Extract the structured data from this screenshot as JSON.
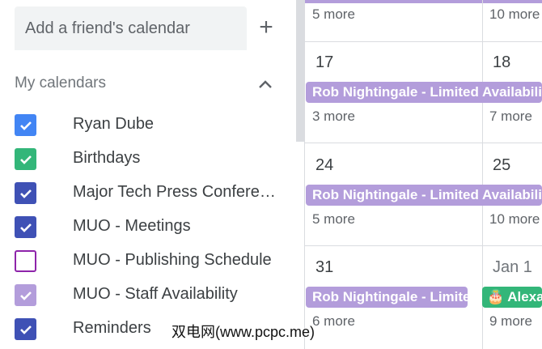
{
  "sidebar": {
    "add_friend_placeholder": "Add a friend's calendar",
    "add_icon": "plus-icon",
    "my_calendars_title": "My calendars",
    "collapse_icon": "chevron-up-icon",
    "calendars": [
      {
        "label": "Ryan Dube",
        "checked": true,
        "color": "#4285f4"
      },
      {
        "label": "Birthdays",
        "checked": true,
        "color": "#33b679"
      },
      {
        "label": "Major Tech Press Confere…",
        "checked": true,
        "color": "#3f51b5"
      },
      {
        "label": "MUO - Meetings",
        "checked": true,
        "color": "#3f51b5"
      },
      {
        "label": "MUO - Publishing Schedule",
        "checked": false,
        "color": "#8e24aa"
      },
      {
        "label": "MUO - Staff Availability",
        "checked": true,
        "color": "#b39ddb"
      },
      {
        "label": "Reminders",
        "checked": true,
        "color": "#3f51b5"
      }
    ]
  },
  "calendar": {
    "event_color": "#b39ddb",
    "birthday_color": "#33b679",
    "week1": {
      "more_left": "5 more",
      "more_right": "10 more"
    },
    "week2": {
      "date_left": "17",
      "date_right": "18",
      "event": "Rob Nightingale - Limited Availability",
      "more_left": "3 more",
      "more_right": "7 more"
    },
    "week3": {
      "date_left": "24",
      "date_right": "25",
      "event": "Rob Nightingale - Limited Availability",
      "more_left": "5 more",
      "more_right": "10 more"
    },
    "week4": {
      "date_left": "31",
      "date_right": "Jan 1",
      "event": "Rob Nightingale - Limited Availability",
      "birthday_event": "Alexa",
      "more_left": "6 more",
      "more_right": "9 more"
    }
  },
  "watermark": "双电网(www.pcpc.me)"
}
